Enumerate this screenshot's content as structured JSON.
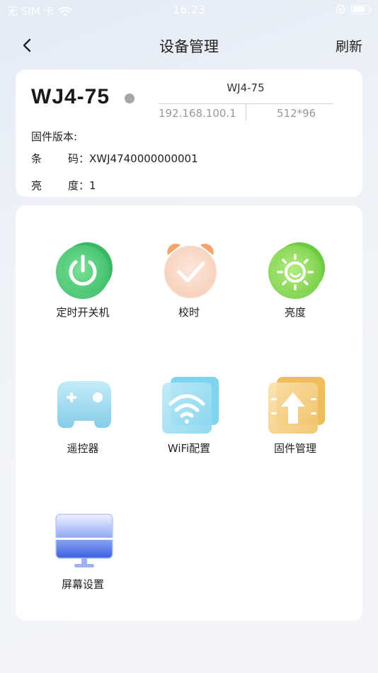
{
  "status_bar": {
    "carrier": "无 SIM 卡",
    "time": "16:23"
  },
  "nav": {
    "title": "设备管理",
    "refresh_label": "刷新"
  },
  "device": {
    "name": "WJ4-75",
    "model": "WJ4-75",
    "ip": "192.168.100.1",
    "resolution": "512*96",
    "firmware_label": "固件版本:",
    "firmware_value": "",
    "barcode_label_a": "条",
    "barcode_label_b": "码：",
    "barcode_value": "XWJ4740000000001",
    "brightness_label_a": "亮",
    "brightness_label_b": "度：",
    "brightness_value": "1"
  },
  "menu": [
    {
      "label": "定时开关机",
      "icon": "power-icon"
    },
    {
      "label": "校时",
      "icon": "alarm-clock-icon"
    },
    {
      "label": "亮度",
      "icon": "sun-icon"
    },
    {
      "label": "遥控器",
      "icon": "gamepad-icon"
    },
    {
      "label": "WiFi配置",
      "icon": "wifi-icon"
    },
    {
      "label": "固件管理",
      "icon": "upload-icon"
    },
    {
      "label": "屏幕设置",
      "icon": "monitor-icon"
    }
  ],
  "colors": {
    "power": "#3fbf6a",
    "alarm": "#f4a56e",
    "sun": "#7ed34f",
    "gamepad": "#8fd3ef",
    "wifi": "#7fd4ee",
    "upload": "#f2c46a",
    "monitor": "#4d6fe4",
    "status_dot": "#a6a6a6"
  }
}
